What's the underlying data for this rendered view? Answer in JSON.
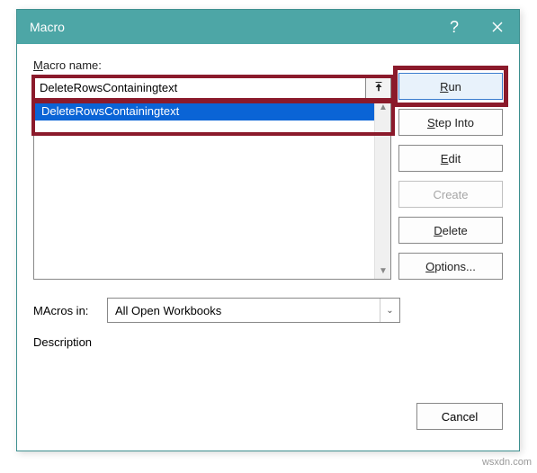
{
  "dialog": {
    "title": "Macro",
    "macro_name_label_prefix": "M",
    "macro_name_label_rest": "acro name:",
    "macro_name_value": "DeleteRowsContainingtext",
    "list_item": "DeleteRowsContainingtext",
    "macros_in_label": "Macros in:",
    "macros_in_accel": "A",
    "macros_in_value": "All Open Workbooks",
    "description_label": "Description"
  },
  "buttons": {
    "run": "un",
    "run_accel": "R",
    "step": "tep Into",
    "step_accel": "S",
    "edit": "dit",
    "edit_accel": "E",
    "create": "reate",
    "create_accel": "C",
    "delete": "elete",
    "delete_accel": "D",
    "options": "ptions...",
    "options_accel": "O",
    "cancel": "Cancel"
  },
  "watermark": "wsxdn.com"
}
